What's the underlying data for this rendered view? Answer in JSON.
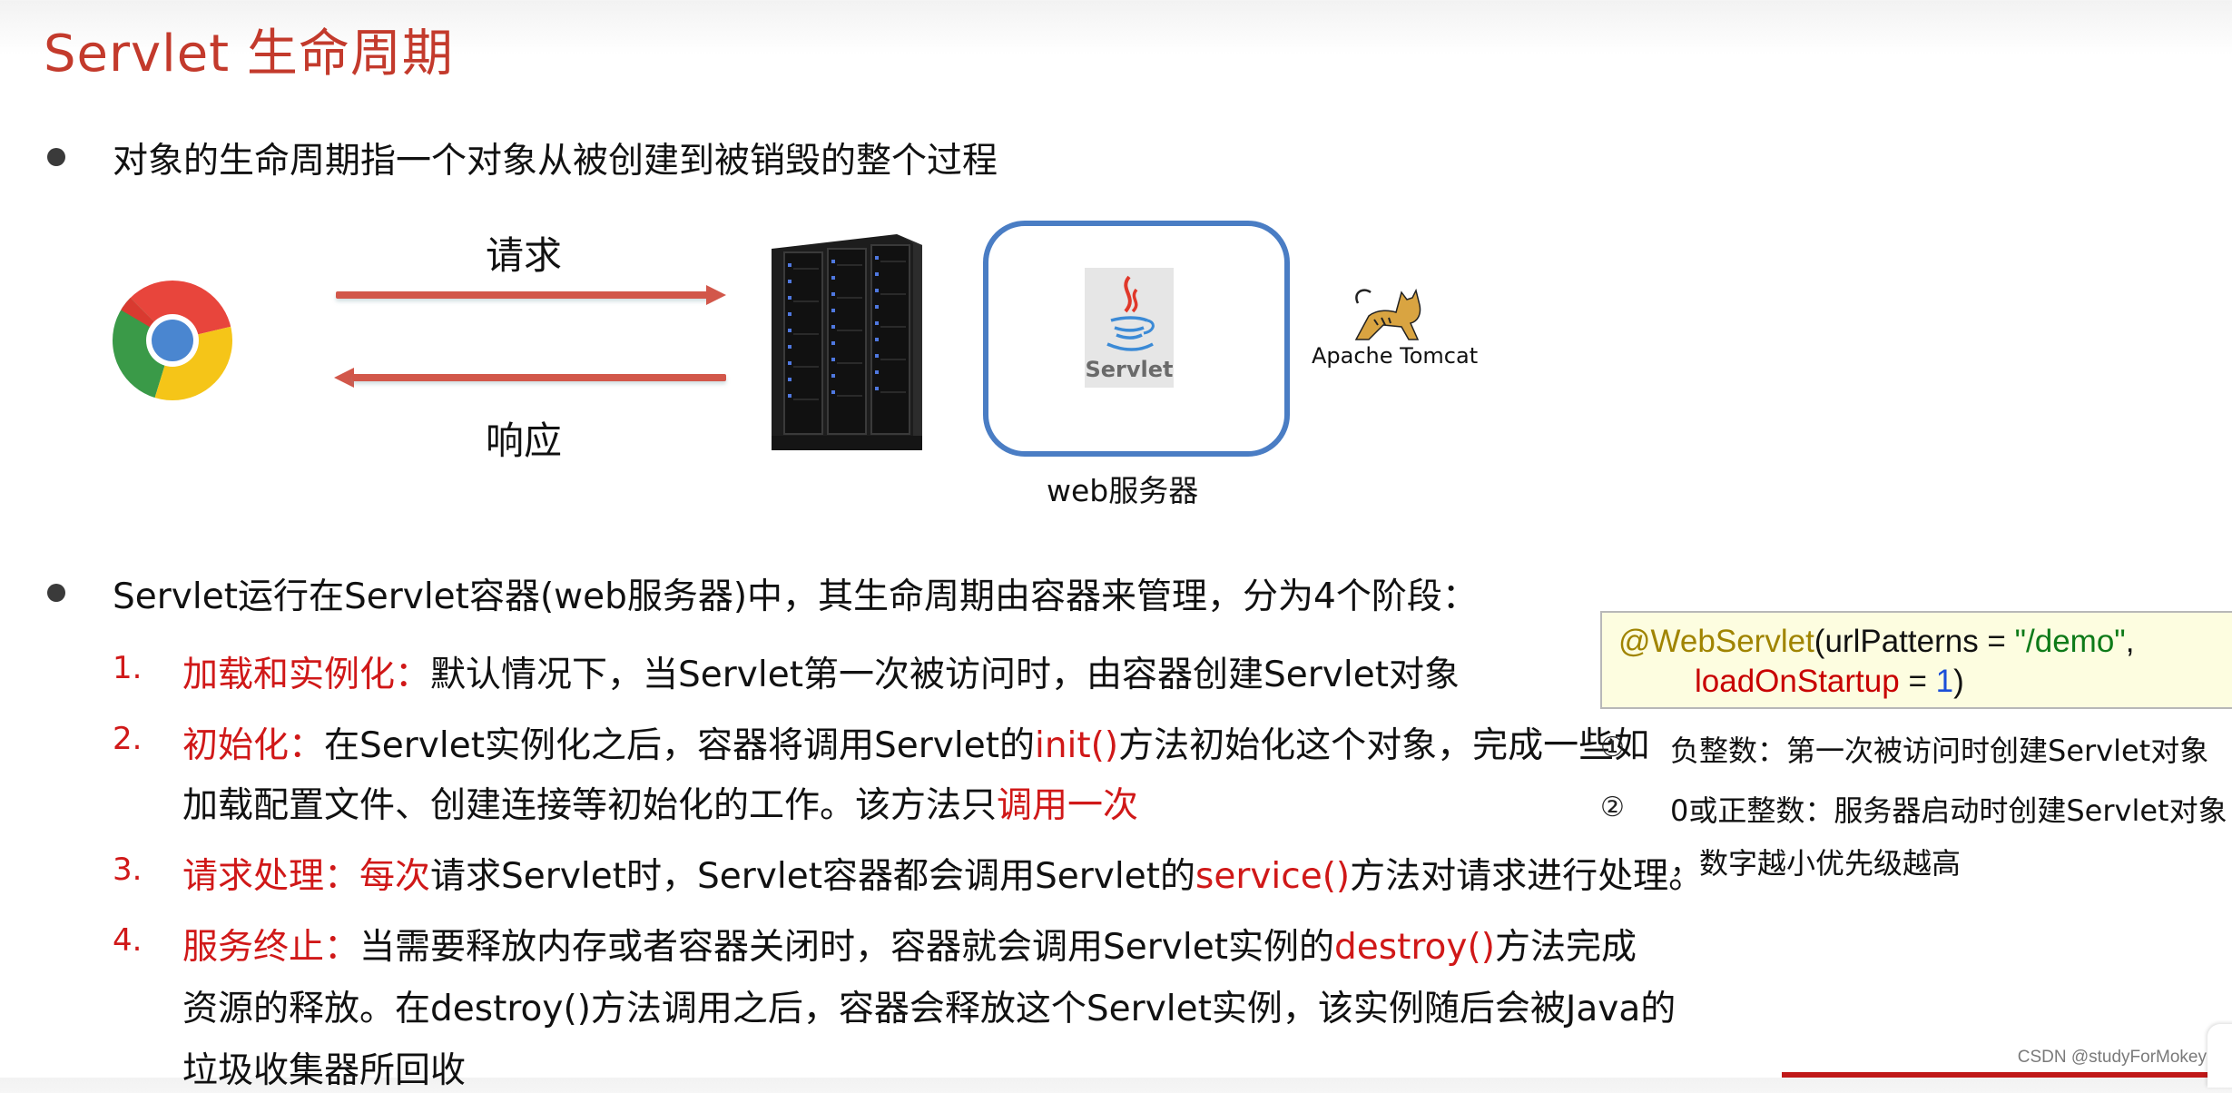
{
  "slide": {
    "title": "Servlet 生命周期",
    "bullet1": "对象的生命周期指一个对象从被创建到被销毁的整个过程",
    "diagram": {
      "request_label": "请求",
      "response_label": "响应",
      "server_caption": "web服务器",
      "servlet_logo_text": "Servlet",
      "tomcat_label": "Apache Tomcat",
      "icons": {
        "browser": "chrome-icon",
        "server": "server-rack-icon",
        "servlet": "java-servlet-logo",
        "tomcat": "tomcat-cat-logo"
      },
      "arrow_color": "#d2574a",
      "box_color": "#4a7dc4"
    },
    "bullet2": "Servlet运行在Servlet容器(web服务器)中，其生命周期由容器来管理，分为4个阶段：",
    "stages": [
      {
        "number": "1.",
        "label": "加载和实例化：",
        "lines": [
          [
            {
              "text": "默认情况下，当Servlet第一次被访问时，由容器创建Servlet对象",
              "red": false
            }
          ]
        ]
      },
      {
        "number": "2.",
        "label": "初始化：",
        "lines": [
          [
            {
              "text": "在Servlet实例化之后，容器将调用Servlet的",
              "red": false
            },
            {
              "text": "init()",
              "red": true
            },
            {
              "text": "方法初始化这个对象，完成一些如",
              "red": false
            }
          ],
          [
            {
              "text": "加载配置文件、创建连接等初始化的工作。该方法只",
              "red": false
            },
            {
              "text": "调用一次",
              "red": true
            }
          ]
        ]
      },
      {
        "number": "3.",
        "label": "请求处理：",
        "lines": [
          [
            {
              "text": "每次",
              "red": true
            },
            {
              "text": "请求Servlet时，Servlet容器都会调用Servlet的",
              "red": false
            },
            {
              "text": "service()",
              "red": true
            },
            {
              "text": "方法对请求进行处理。",
              "red": false
            }
          ]
        ]
      },
      {
        "number": "4.",
        "label": "服务终止：",
        "lines": [
          [
            {
              "text": "当需要释放内存或者容器关闭时，容器就会调用Servlet实例的",
              "red": false
            },
            {
              "text": "destroy()",
              "red": true
            },
            {
              "text": "方法完成",
              "red": false
            }
          ],
          [
            {
              "text": "资源的释放。在destroy()方法调用之后，容器会释放这个Servlet实例，该实例随后会被Java的",
              "red": false
            }
          ],
          [
            {
              "text": "垃圾收集器所回收",
              "red": false
            }
          ]
        ]
      }
    ],
    "code": {
      "annotation": "@WebServlet",
      "open_paren": "(",
      "param1_name": "urlPatterns",
      "equals": " = ",
      "param1_value": "\"/demo\"",
      "comma": ",",
      "param2_name": "loadOnStartup",
      "param2_value": "1",
      "close_paren": ")"
    },
    "notes": [
      {
        "marker": "①",
        "text": "负整数：第一次被访问时创建Servlet对象"
      },
      {
        "marker": "②",
        "text": "0或正整数：服务器启动时创建Servlet对象",
        "continuation": "，数字越小优先级越高"
      }
    ],
    "watermark": "CSDN @studyForMokey",
    "colors": {
      "title": "#c33a2c",
      "highlight_red": "#d01818",
      "code_annotation": "#a08400",
      "code_attr": "#c80000",
      "code_string": "#0d7a18",
      "code_number": "#1b4fd8",
      "code_bg": "#fdfde0"
    }
  }
}
